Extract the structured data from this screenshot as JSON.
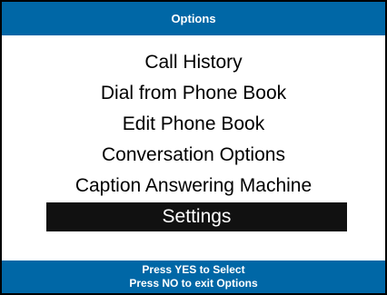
{
  "header": {
    "title": "Options"
  },
  "menu": {
    "items": [
      {
        "label": "Call History"
      },
      {
        "label": "Dial from Phone Book"
      },
      {
        "label": "Edit Phone Book"
      },
      {
        "label": "Conversation Options"
      },
      {
        "label": "Caption Answering Machine"
      },
      {
        "label": "Settings",
        "selected": true
      }
    ]
  },
  "footer": {
    "line1": "Press YES to Select",
    "line2": "Press NO to exit Options"
  },
  "colors": {
    "bar": "#0067a6",
    "selection": "#111111",
    "text": "#000000"
  }
}
